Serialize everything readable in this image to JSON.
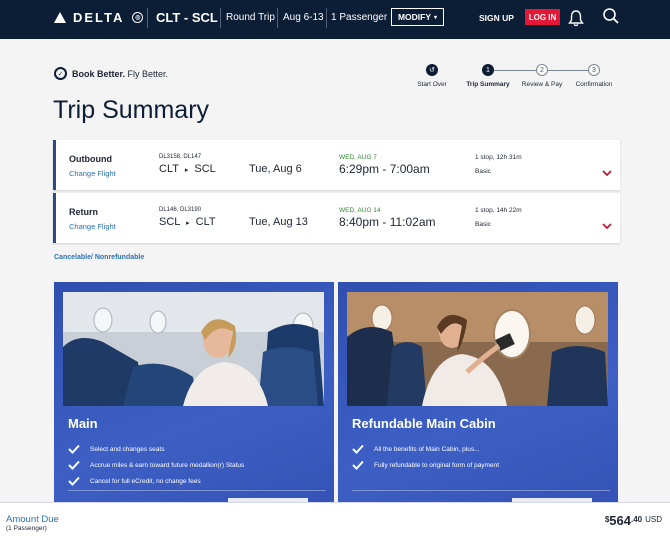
{
  "header": {
    "brand": "DELTA",
    "route": "CLT - SCL",
    "trip_type": "Round Trip",
    "dates": "Aug 6-13",
    "passengers": "1 Passenger",
    "modify_label": "MODIFY",
    "signup_label": "SIGN UP",
    "login_label": "LOG IN"
  },
  "page": {
    "tagline_bold": "Book Better.",
    "tagline_rest": " Fly Better.",
    "title": "Trip Summary"
  },
  "steps": [
    {
      "num": "",
      "label": "Start Over",
      "state": "icon"
    },
    {
      "num": "1",
      "label": "Trip Summary",
      "state": "current"
    },
    {
      "num": "2",
      "label": "Review & Pay",
      "state": "upcoming"
    },
    {
      "num": "3",
      "label": "Confirmation",
      "state": "upcoming"
    }
  ],
  "flights": [
    {
      "direction": "Outbound",
      "change_label": "Change Flight",
      "flight_numbers": "DL3158, DL147",
      "from": "CLT",
      "to": "SCL",
      "date": "Tue, Aug 6",
      "arrival_day": "WED, AUG 7",
      "times": "6:29pm - 7:00am",
      "stops": "1 stop, 12h 31m",
      "fare_class": "Basic"
    },
    {
      "direction": "Return",
      "change_label": "Change Flight",
      "flight_numbers": "DL146, DL3190",
      "from": "SCL",
      "to": "CLT",
      "date": "Tue, Aug 13",
      "arrival_day": "WED, AUG 14",
      "times": "8:40pm - 11:02am",
      "stops": "1 stop, 14h 22m",
      "fare_class": "Basic"
    }
  ],
  "policy_note": "Cancelable/ Nonrefundable",
  "fares": [
    {
      "title": "Main",
      "features": [
        "Select and changes seats",
        "Accrue miles & earn toward future medallion(r) Status",
        "Cancel for full eCredit, no change fees"
      ]
    },
    {
      "title": "Refundable Main Cabin",
      "features": [
        "All the benefits of Main Cabin, plus...",
        "Fully refundable to original form of payment"
      ]
    }
  ],
  "footer": {
    "amount_label": "Amount Due",
    "amount_sub": "(1 Passenger)",
    "currency_symbol": "$",
    "price_whole": "564",
    "price_cents": ".40",
    "currency": "USD"
  },
  "colors": {
    "navy": "#0c1d36",
    "login_red": "#e31837",
    "card_blue": "#3553b7",
    "link_blue": "#2a72b5",
    "arrival_green": "#2f8a2f"
  }
}
